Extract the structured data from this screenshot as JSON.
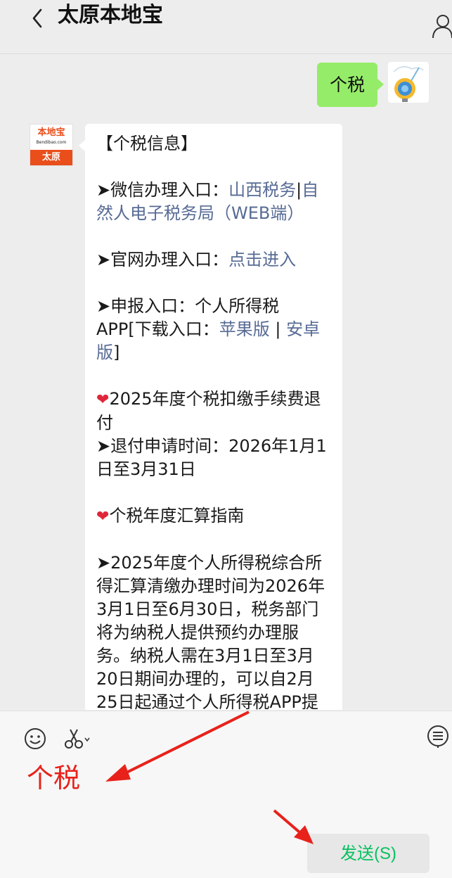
{
  "header": {
    "title": "太原本地宝"
  },
  "chat": {
    "user_message": "个税",
    "bot_avatar": {
      "brand": "本地宝",
      "url": "Bendibao.com",
      "city": "太原"
    },
    "bot_message": {
      "l1": "【个税信息】",
      "l2_prefix": "➤微信办理入口：",
      "l2_link1": "山西税务",
      "l2_sep": "|",
      "l2_link2": "自然人电子税务局（WEB端）",
      "l3_prefix": "➤官网办理入口：",
      "l3_link": "点击进入",
      "l4_prefix": "➤申报入口：个人所得税APP[下载入口：",
      "l4_link1": "苹果版",
      "l4_sep": " | ",
      "l4_link2": "安卓版",
      "l4_suffix": "]",
      "l5_icon": "❤",
      "l5_text": "2025年度个税扣缴手续费退付",
      "l6": "➤退付申请时间：2026年1月1日至3月31日",
      "l7_icon": "❤",
      "l7_text": "个税年度汇算指南",
      "l8": "➤2025年度个人所得税综合所得汇算清缴办理时间为2026年3月1日至6月30日，税务部门将为纳税人提供预约办理服务。纳税人需在3月1日至3月20日期间办理的，可以自2月25日起通过个人所得税APP提"
    }
  },
  "input": {
    "typed_text": "个税",
    "send_label": "发送(S)"
  },
  "colors": {
    "accent_green": "#07c160",
    "bubble_green": "#95ec69",
    "link_blue": "#576b95",
    "annotation_red": "#e8221b"
  },
  "icons": [
    "back-arrow-icon",
    "profile-icon",
    "emoji-icon",
    "scissors-icon",
    "menu-icon"
  ]
}
